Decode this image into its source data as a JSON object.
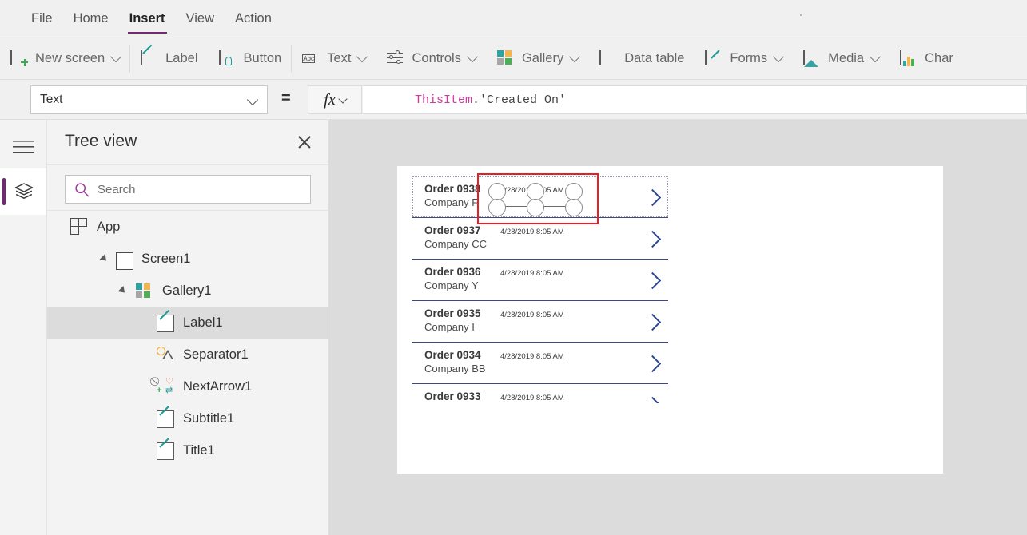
{
  "menu": {
    "items": [
      {
        "label": "File",
        "active": false
      },
      {
        "label": "Home",
        "active": false
      },
      {
        "label": "Insert",
        "active": true
      },
      {
        "label": "View",
        "active": false
      },
      {
        "label": "Action",
        "active": false
      }
    ]
  },
  "ribbon": {
    "items": [
      {
        "label": "New screen",
        "icon": "new-screen-icon",
        "caret": true,
        "divider": true
      },
      {
        "label": "Label",
        "icon": "label-icon",
        "caret": false,
        "divider": false
      },
      {
        "label": "Button",
        "icon": "button-icon",
        "caret": false,
        "divider": true
      },
      {
        "label": "Text",
        "icon": "text-abc-icon",
        "caret": true,
        "divider": false
      },
      {
        "label": "Controls",
        "icon": "controls-icon",
        "caret": true,
        "divider": false
      },
      {
        "label": "Gallery",
        "icon": "gallery-icon",
        "caret": true,
        "divider": false
      },
      {
        "label": "Data table",
        "icon": "data-table-icon",
        "caret": false,
        "divider": false
      },
      {
        "label": "Forms",
        "icon": "forms-icon",
        "caret": true,
        "divider": false
      },
      {
        "label": "Media",
        "icon": "media-icon",
        "caret": true,
        "divider": false
      },
      {
        "label": "Char",
        "icon": "charts-icon",
        "caret": false,
        "divider": false
      }
    ]
  },
  "formula_bar": {
    "property": "Text",
    "equals": "=",
    "fx_label": "fx",
    "formula_object": "ThisItem",
    "formula_rest": ".'Created On'"
  },
  "tree_view": {
    "title": "Tree view",
    "search_placeholder": "Search",
    "items": [
      {
        "label": "App",
        "icon": "app-icon",
        "indent": 0,
        "twisty": false,
        "selected": false
      },
      {
        "label": "Screen1",
        "icon": "screen-icon",
        "indent": 1,
        "twisty": true,
        "selected": false
      },
      {
        "label": "Gallery1",
        "icon": "gallery-icon",
        "indent": 2,
        "twisty": true,
        "selected": false
      },
      {
        "label": "Label1",
        "icon": "label-icon",
        "indent": 3,
        "twisty": false,
        "selected": true
      },
      {
        "label": "Separator1",
        "icon": "shapes-icon",
        "indent": 3,
        "twisty": false,
        "selected": false
      },
      {
        "label": "NextArrow1",
        "icon": "icons-icon",
        "indent": 3,
        "twisty": false,
        "selected": false
      },
      {
        "label": "Subtitle1",
        "icon": "label-icon",
        "indent": 3,
        "twisty": false,
        "selected": false
      },
      {
        "label": "Title1",
        "icon": "label-icon",
        "indent": 3,
        "twisty": false,
        "selected": false
      }
    ]
  },
  "canvas": {
    "gallery_rows": [
      {
        "title": "Order 0938",
        "subtitle": "Company F",
        "date": "4/28/2019 8:05 AM"
      },
      {
        "title": "Order 0937",
        "subtitle": "Company CC",
        "date": "4/28/2019 8:05 AM"
      },
      {
        "title": "Order 0936",
        "subtitle": "Company Y",
        "date": "4/28/2019 8:05 AM"
      },
      {
        "title": "Order 0935",
        "subtitle": "Company I",
        "date": "4/28/2019 8:05 AM"
      },
      {
        "title": "Order 0934",
        "subtitle": "Company BB",
        "date": "4/28/2019 8:05 AM"
      },
      {
        "title": "Order 0933",
        "subtitle": "",
        "date": "4/28/2019 8:05 AM"
      }
    ]
  },
  "colors": {
    "accent_purple": "#742774",
    "annotation_red": "#ee1b22",
    "arrow_blue": "#2b4492",
    "formula_token": "#d1399b"
  }
}
